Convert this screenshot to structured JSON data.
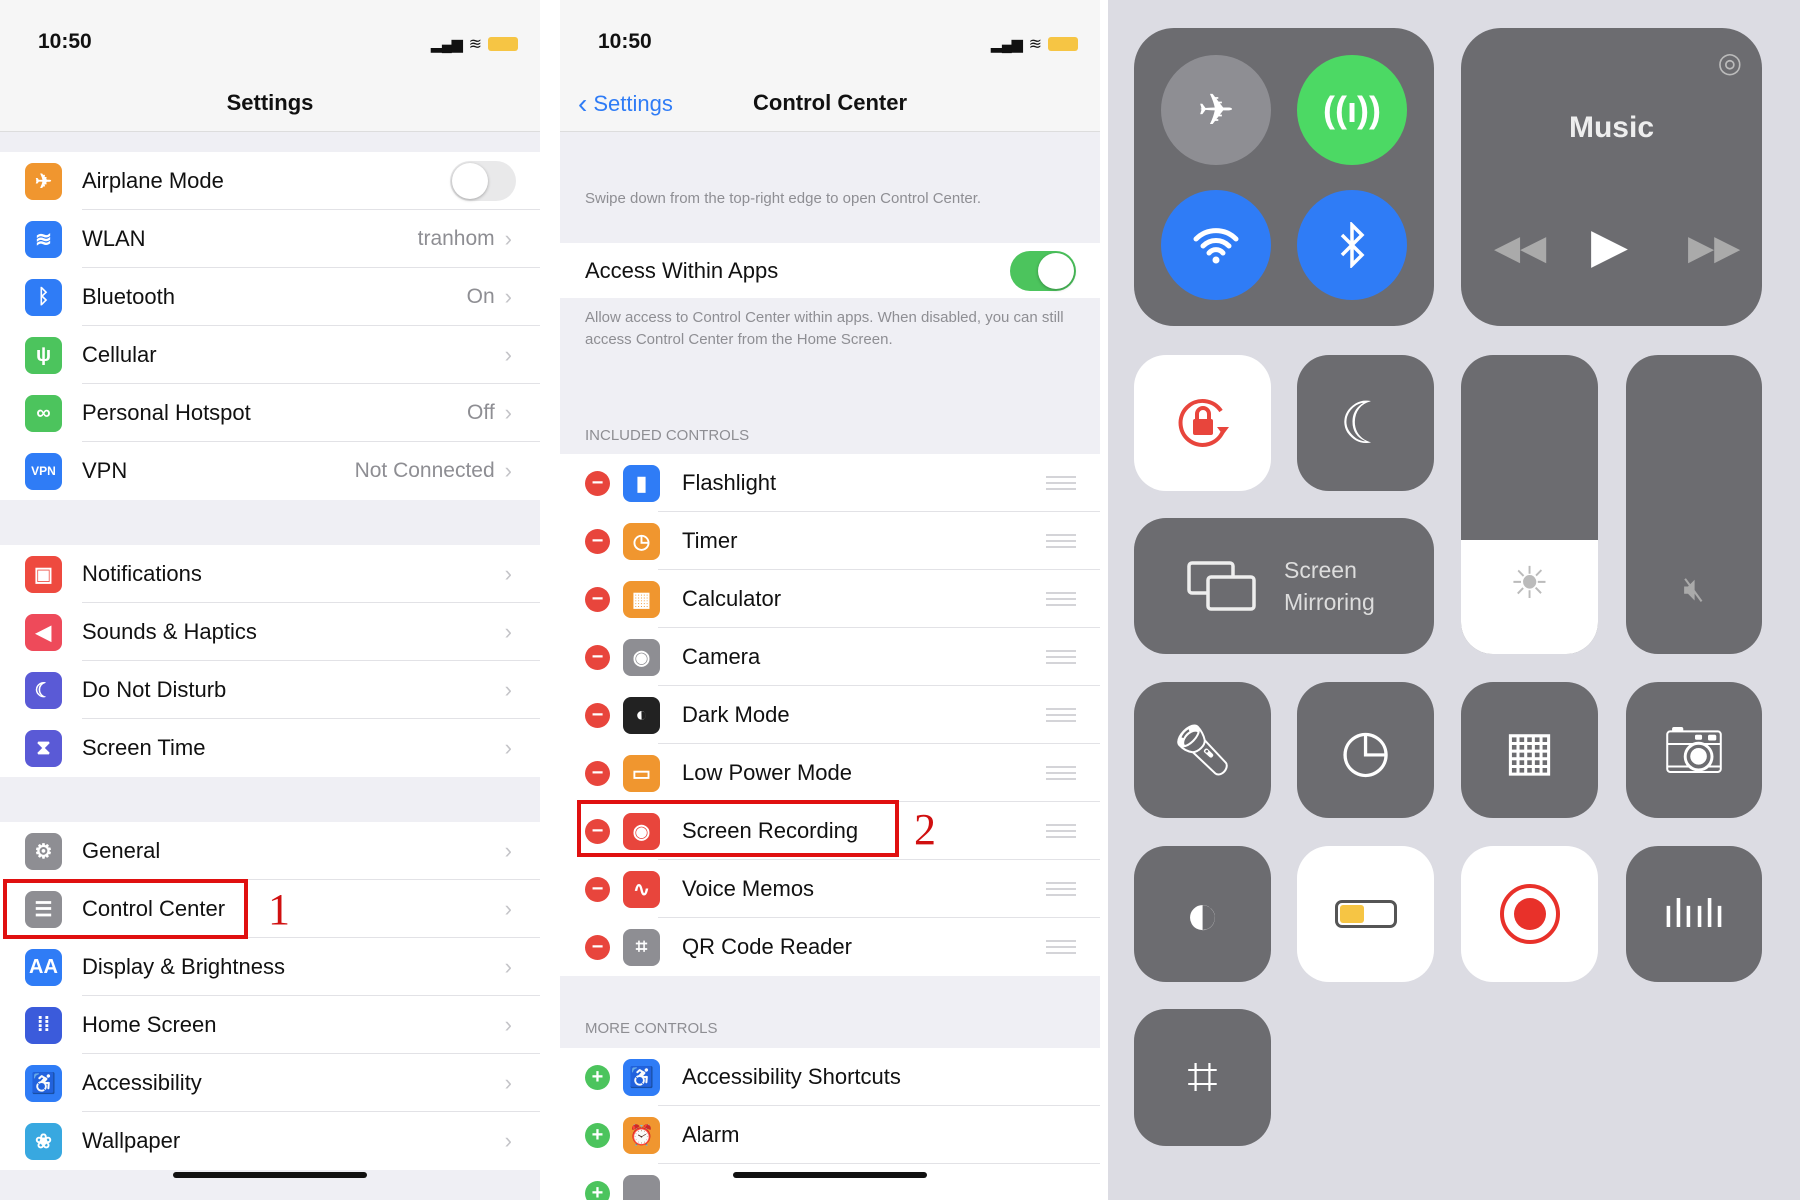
{
  "status_time": "10:50",
  "settings": {
    "title": "Settings",
    "groups": [
      [
        {
          "label": "Airplane Mode",
          "icon": "airplane-icon",
          "color": "#f0962f",
          "glyph": "✈",
          "toggle": false
        },
        {
          "label": "WLAN",
          "value": "tranhom",
          "icon": "wifi-icon",
          "color": "#2f7cf6",
          "glyph": "≋"
        },
        {
          "label": "Bluetooth",
          "value": "On",
          "icon": "bluetooth-icon",
          "color": "#2f7cf6",
          "glyph": "ᛒ"
        },
        {
          "label": "Cellular",
          "icon": "cellular-antenna-icon",
          "color": "#4cc45d",
          "glyph": "ψ"
        },
        {
          "label": "Personal Hotspot",
          "value": "Off",
          "icon": "hotspot-icon",
          "color": "#4cc45d",
          "glyph": "∞"
        },
        {
          "label": "VPN",
          "value": "Not Connected",
          "icon": "vpn-icon",
          "color": "#2f7cf6",
          "glyph": "VPN"
        }
      ],
      [
        {
          "label": "Notifications",
          "icon": "notifications-icon",
          "color": "#ee4a3f",
          "glyph": "▣"
        },
        {
          "label": "Sounds & Haptics",
          "icon": "speaker-icon",
          "color": "#ee4a5a",
          "glyph": "◀"
        },
        {
          "label": "Do Not Disturb",
          "icon": "moon-icon",
          "color": "#5a5ad6",
          "glyph": "☾"
        },
        {
          "label": "Screen Time",
          "icon": "hourglass-icon",
          "color": "#5a5ad6",
          "glyph": "⧗"
        }
      ],
      [
        {
          "label": "General",
          "icon": "gear-icon",
          "color": "#8e8e93",
          "glyph": "⚙"
        },
        {
          "label": "Control Center",
          "icon": "switches-icon",
          "color": "#8e8e93",
          "glyph": "☰"
        },
        {
          "label": "Display & Brightness",
          "icon": "display-icon",
          "color": "#2f7cf6",
          "glyph": "AA"
        },
        {
          "label": "Home Screen",
          "icon": "home-screen-grid-icon",
          "color": "#3b5bdb",
          "glyph": "⁞⁞"
        },
        {
          "label": "Accessibility",
          "icon": "accessibility-icon",
          "color": "#2f7cf6",
          "glyph": "♿"
        },
        {
          "label": "Wallpaper",
          "icon": "wallpaper-flower-icon",
          "color": "#38a8e0",
          "glyph": "❀"
        }
      ]
    ],
    "annotation": "1"
  },
  "control_center": {
    "back_label": "Settings",
    "title": "Control Center",
    "swipe_note": "Swipe down from the top-right edge to open Control Center.",
    "access_label": "Access Within Apps",
    "access_on": true,
    "access_note": "Allow access to Control Center within apps. When disabled, you can still access Control Center from the Home Screen.",
    "included_header": "INCLUDED CONTROLS",
    "included": [
      {
        "label": "Flashlight",
        "icon": "flashlight-icon",
        "color": "#2f7cf6",
        "glyph": "▮"
      },
      {
        "label": "Timer",
        "icon": "timer-icon",
        "color": "#f0962f",
        "glyph": "◷"
      },
      {
        "label": "Calculator",
        "icon": "calculator-icon",
        "color": "#f0962f",
        "glyph": "▦"
      },
      {
        "label": "Camera",
        "icon": "camera-icon",
        "color": "#8e8e93",
        "glyph": "◉"
      },
      {
        "label": "Dark Mode",
        "icon": "dark-mode-icon",
        "color": "#222222",
        "glyph": "◐"
      },
      {
        "label": "Low Power Mode",
        "icon": "battery-icon",
        "color": "#f0962f",
        "glyph": "▭"
      },
      {
        "label": "Screen Recording",
        "icon": "record-icon",
        "color": "#e8453c",
        "glyph": "◉"
      },
      {
        "label": "Voice Memos",
        "icon": "waveform-icon",
        "color": "#e8453c",
        "glyph": "∿"
      },
      {
        "label": "QR Code Reader",
        "icon": "qr-code-icon",
        "color": "#8e8e93",
        "glyph": "⌗"
      }
    ],
    "more_header": "MORE CONTROLS",
    "more": [
      {
        "label": "Accessibility Shortcuts",
        "icon": "accessibility-icon",
        "color": "#2f7cf6",
        "glyph": "♿"
      },
      {
        "label": "Alarm",
        "icon": "alarm-icon",
        "color": "#f0962f",
        "glyph": "⏰"
      },
      {
        "label": "",
        "icon": "remote-icon",
        "color": "#8e8e93",
        "glyph": ""
      }
    ],
    "annotation": "2"
  },
  "cc_panel": {
    "music_label": "Music",
    "screen_mirroring_line1": "Screen",
    "screen_mirroring_line2": "Mirroring",
    "brightness_level": 0.38,
    "volume_level": 0,
    "colors": {
      "cellular_on": "#4cd964",
      "wifi_on": "#2f7cf6",
      "bluetooth_on": "#2f7cf6",
      "tile": "#6c6c70",
      "record": "#e8312a"
    }
  }
}
